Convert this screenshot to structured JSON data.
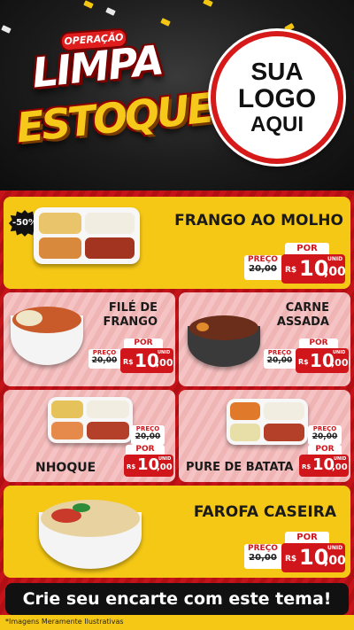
{
  "header": {
    "operation_label": "OPERAÇÃO",
    "title_line1": "LIMPA",
    "title_line2": "ESTOQUE",
    "logo": {
      "line1": "SUA",
      "line2": "LOGO",
      "line3": "AQUI"
    }
  },
  "price_labels": {
    "por": "POR",
    "preco": "PREÇO",
    "unid": "UNID",
    "currency": "R$"
  },
  "products": [
    {
      "name_line1": "FRANGO AO MOLHO",
      "name_line2": "",
      "badge": "-50%",
      "old_price": "20,00",
      "price_int": "10",
      "price_dec": ",00"
    },
    {
      "name_line1": "FILÉ DE",
      "name_line2": "FRANGO",
      "old_price": "20,00",
      "price_int": "10",
      "price_dec": ",00"
    },
    {
      "name_line1": "CARNE",
      "name_line2": "ASSADA",
      "old_price": "20,00",
      "price_int": "10",
      "price_dec": ",00"
    },
    {
      "name_line1": "NHOQUE",
      "name_line2": "",
      "old_price": "20,00",
      "price_int": "10",
      "price_dec": ",00"
    },
    {
      "name_line1": "PURE DE BATATA",
      "name_line2": "",
      "old_price": "20,00",
      "price_int": "10",
      "price_dec": ",00"
    },
    {
      "name_line1": "FAROFA CASEIRA",
      "name_line2": "",
      "old_price": "20,00",
      "price_int": "10",
      "price_dec": ",00"
    }
  ],
  "banner": "Crie seu encarte com este tema!",
  "footnote": "*Imagens Meramente Ilustrativas",
  "colors": {
    "red": "#d0151b",
    "yellow": "#f6c816",
    "pink": "#f5c3c3",
    "dark": "#111111"
  }
}
